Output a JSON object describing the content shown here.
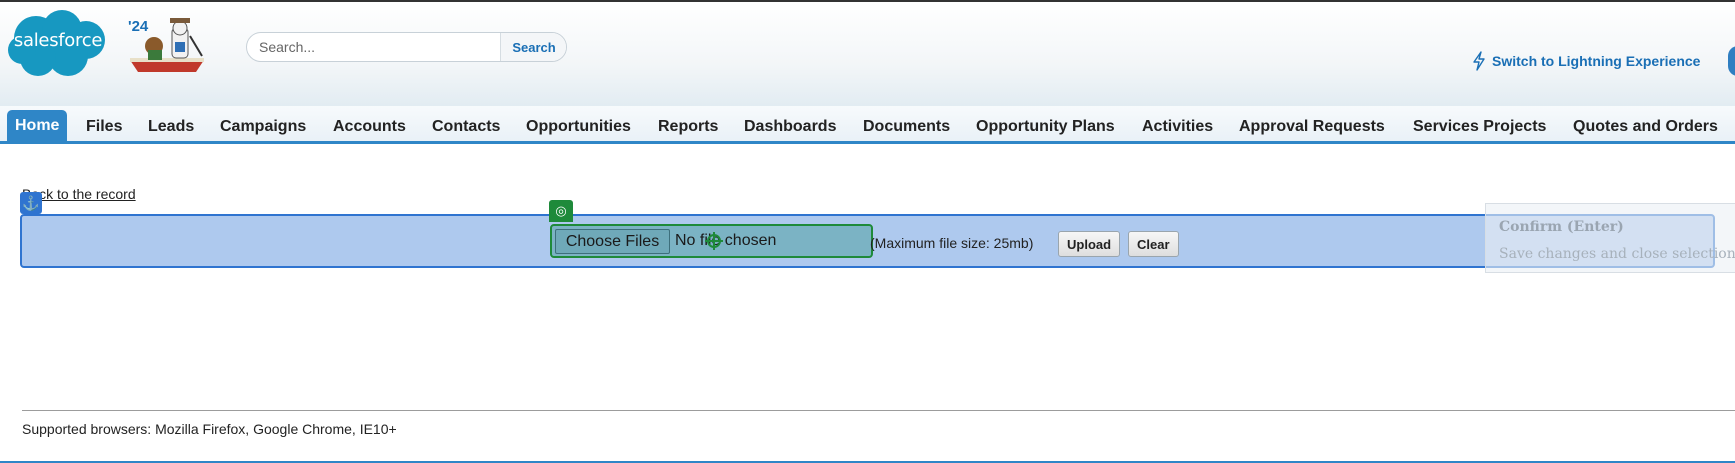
{
  "header": {
    "logo_text": "salesforce",
    "mascot_year": "'24",
    "search_placeholder": "Search...",
    "search_button": "Search",
    "switch_link": "Switch to Lightning Experience"
  },
  "tabs": [
    {
      "label": "Home",
      "active": true
    },
    {
      "label": "Files"
    },
    {
      "label": "Leads"
    },
    {
      "label": "Campaigns"
    },
    {
      "label": "Accounts"
    },
    {
      "label": "Contacts"
    },
    {
      "label": "Opportunities"
    },
    {
      "label": "Reports"
    },
    {
      "label": "Dashboards"
    },
    {
      "label": "Documents"
    },
    {
      "label": "Opportunity Plans"
    },
    {
      "label": "Activities"
    },
    {
      "label": "Approval Requests"
    },
    {
      "label": "Services Projects"
    },
    {
      "label": "Quotes and Orders"
    }
  ],
  "main": {
    "back_link": "Back to the record",
    "choose_files": "Choose Files",
    "no_file": "No file chosen",
    "max_size": "(Maximum file size: 25mb)",
    "upload": "Upload",
    "clear": "Clear"
  },
  "overlay": {
    "confirm_title": "Confirm (Enter)",
    "confirm_sub": "Save changes and close selection window"
  },
  "footer": {
    "supported": "Supported browsers: Mozilla Firefox, Google Chrome, IE10+"
  },
  "colors": {
    "brand_blue": "#2f86c7",
    "selection_blue": "#2f74d0",
    "selection_green": "#1e8a3a"
  }
}
